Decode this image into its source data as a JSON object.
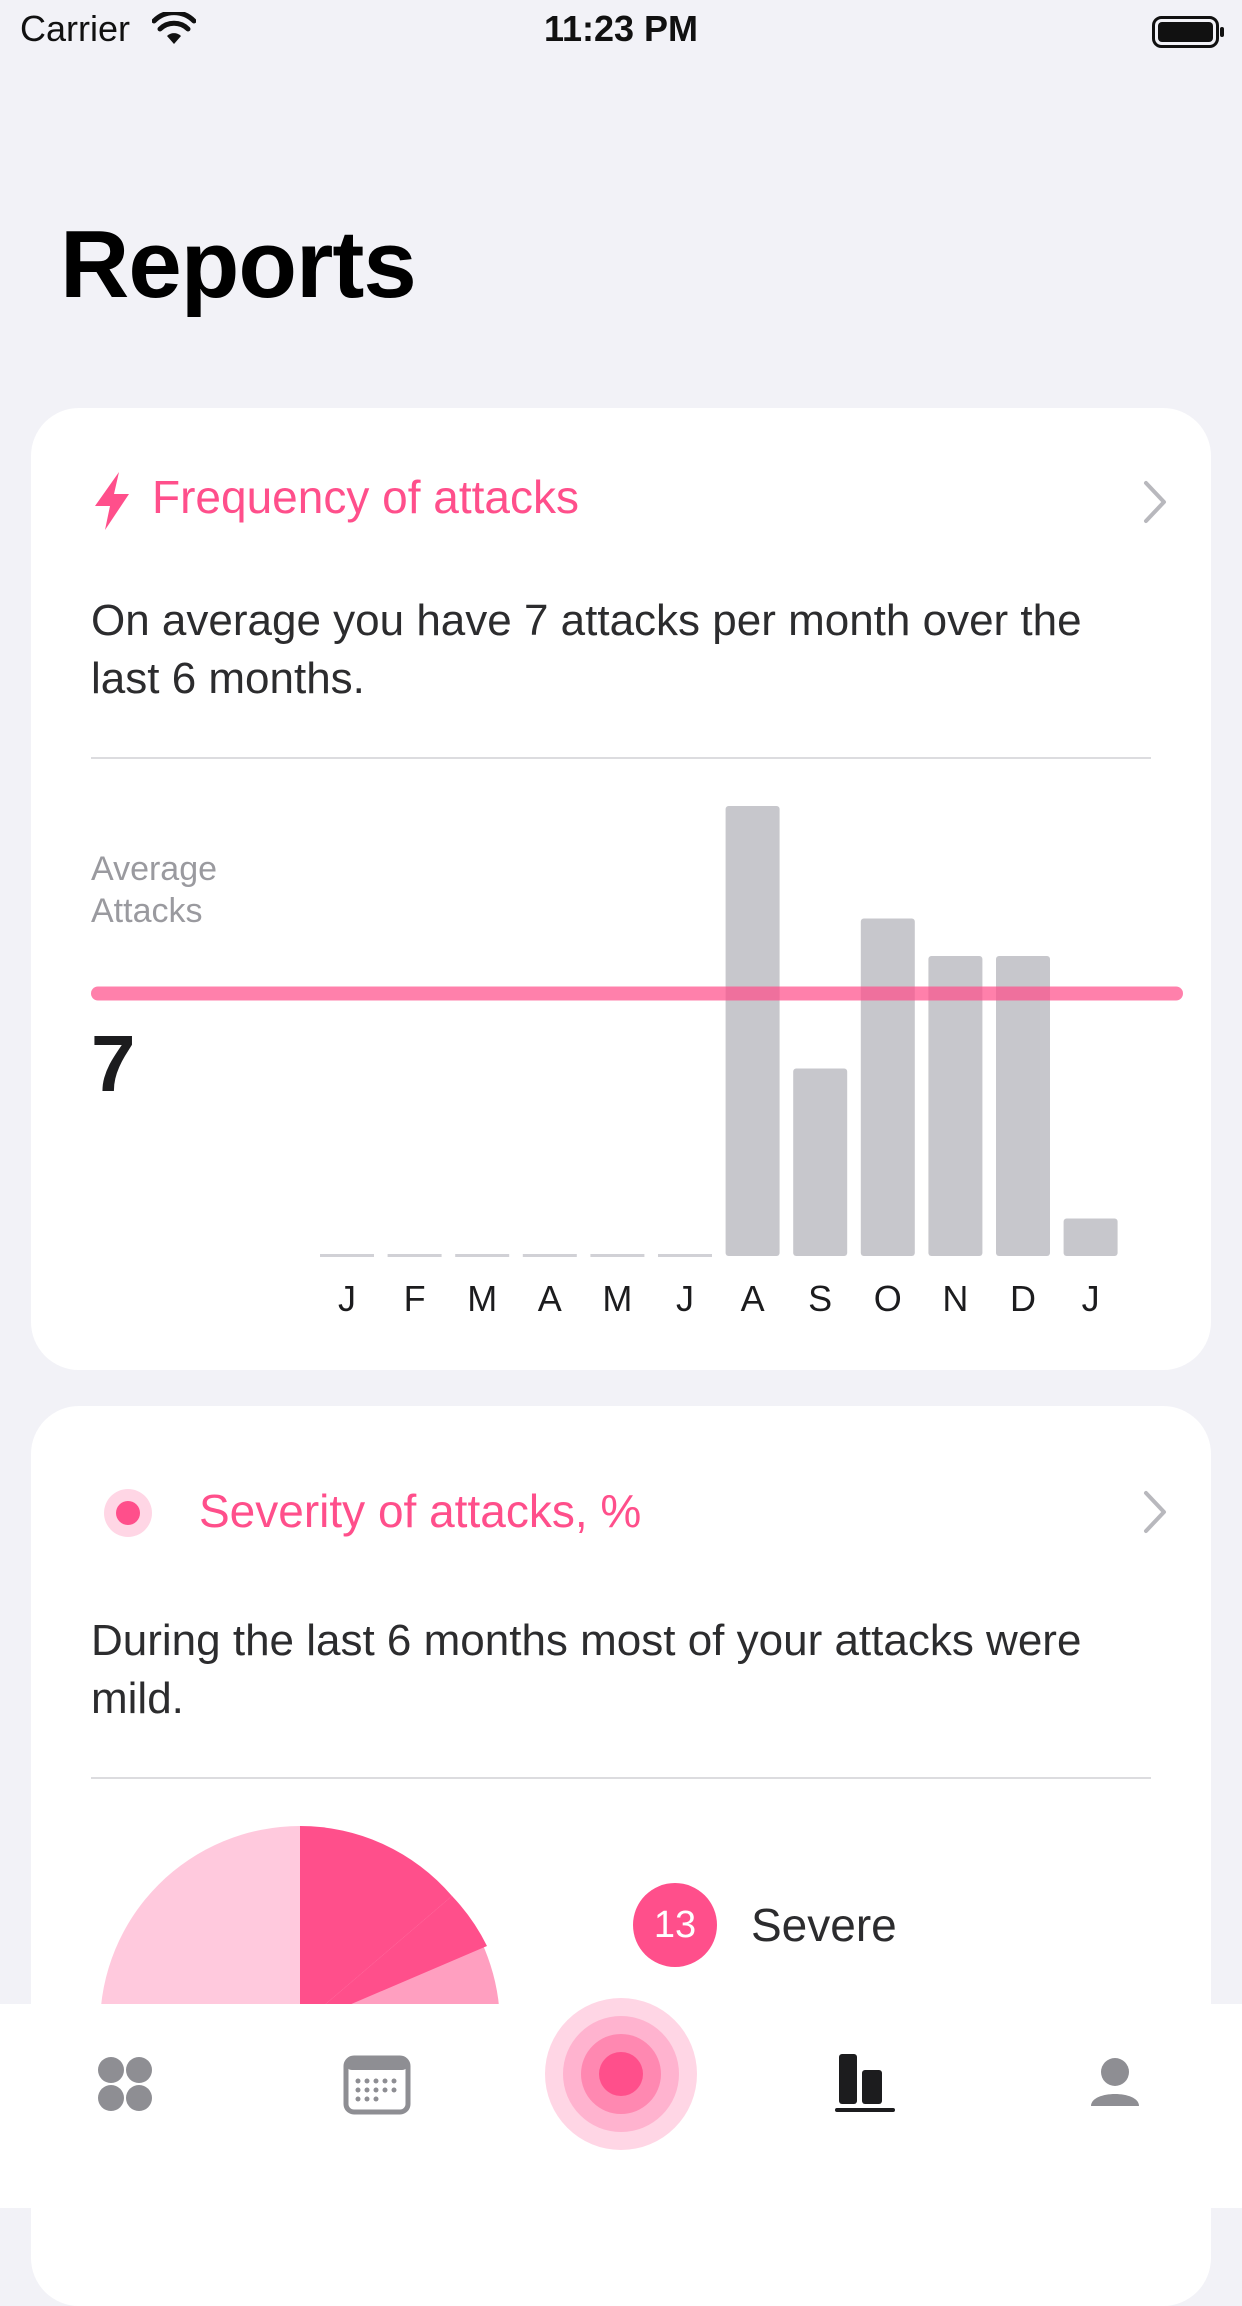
{
  "status_bar": {
    "carrier": "Carrier",
    "time": "11:23 PM"
  },
  "page_title": "Reports",
  "frequency_card": {
    "title": "Frequency of attacks",
    "description": "On average you have 7 attacks per month over the last 6 months.",
    "average_label": "Average Attacks",
    "average_value": "7",
    "chart_data": {
      "type": "bar",
      "categories": [
        "J",
        "F",
        "M",
        "A",
        "M",
        "J",
        "A",
        "S",
        "O",
        "N",
        "D",
        "J"
      ],
      "values": [
        0,
        0,
        0,
        0,
        0,
        0,
        12,
        5,
        9,
        8,
        8,
        1
      ],
      "reference_line": 7,
      "ylim": [
        0,
        12
      ]
    }
  },
  "severity_card": {
    "title": "Severity of attacks, %",
    "description": "During the last 6 months most of your attacks were mild.",
    "legend": [
      {
        "value": "13",
        "label": "Severe"
      }
    ]
  },
  "icons": {
    "frequency": "lightning-icon",
    "severity": "dot-target-icon",
    "chevron": "chevron-right-icon"
  },
  "colors": {
    "accent": "#ff4f8b",
    "accent_light": "#ffc9dd",
    "bar": "#c7c7cc",
    "background": "#f2f2f7"
  },
  "tabbar": {
    "items": [
      {
        "name": "dashboard",
        "icon": "grid-dots-icon"
      },
      {
        "name": "calendar",
        "icon": "calendar-icon"
      },
      {
        "name": "record-attack",
        "icon": "pulse-target-icon"
      },
      {
        "name": "reports",
        "icon": "bar-chart-icon",
        "selected": true
      },
      {
        "name": "profile",
        "icon": "person-icon"
      }
    ]
  }
}
